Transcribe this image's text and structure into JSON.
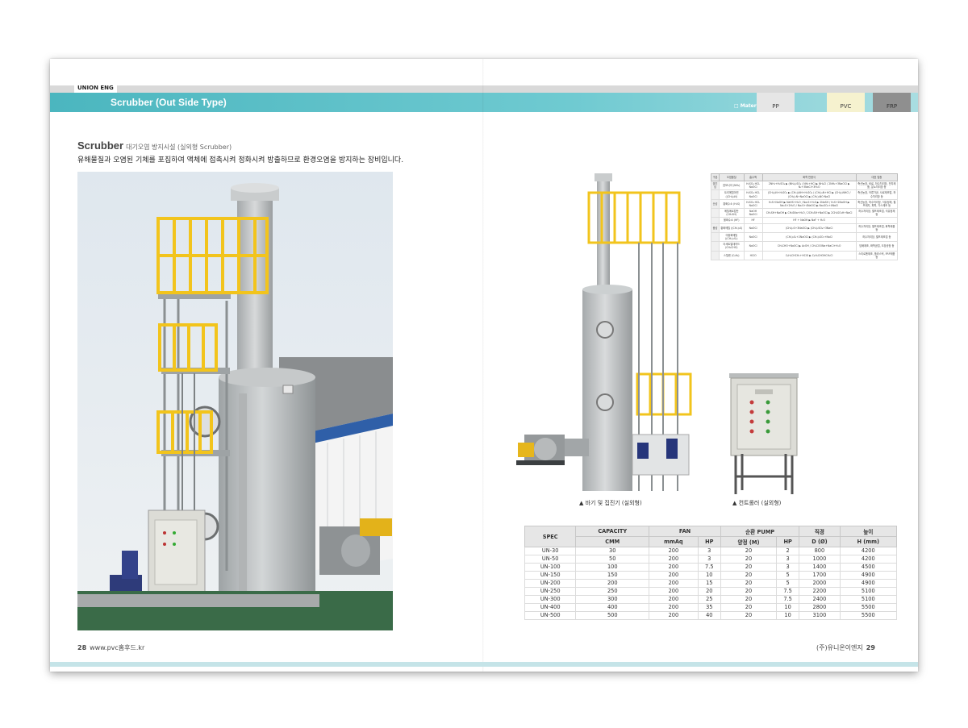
{
  "header": {
    "brand": "UNION ENG",
    "title": "Scrubber (Out Side Type)",
    "material_label": "□ Material",
    "materials": [
      "PP",
      "PVC",
      "FRP"
    ]
  },
  "left_page": {
    "heading": "Scrubber",
    "subheading": "대기오염 방지시설 (실외형 Scrubber)",
    "description": "유해물질과 오염된 기체를 포집하여 액체에 접촉시켜 정화시켜 방출하므로 환경오염을 방지하는 장비입니다.",
    "page_number": "28",
    "website": "www.pvc홈후드.kr"
  },
  "right_page": {
    "caption_scrubber": "▲ 바기 및 집진기 (실외형)",
    "caption_panel": "▲ 컨트롤러 (실외형)",
    "company": "(주)유니온이엔지",
    "page_number": "29"
  },
  "chem_table": {
    "headers": [
      "구분",
      "오염물질",
      "흡수액",
      "화학 반응식",
      "대표 업종"
    ],
    "rows": [
      {
        "cat": "염기성",
        "pollutant": "암모니아 (NH₃)",
        "absorbent": "H₂SO₄ HCL NaOCl",
        "reaction": "2NH₃+H₂SO₄ ▶ (NH₄)₂SO₄ / NH₃+HCl ▶ NH₄Cl / 2NH₃+3NaOCl ▶ N₂+3NaCl+3H₂O",
        "industry": "축산농장, 비료, 하수처리장, 전자제품, 분뇨처리장 등"
      },
      {
        "cat": "",
        "pollutant": "트리메틸아민 ((CH₃)₃N)",
        "absorbent": "H₂SO₄ HCL NaOCl",
        "reaction": "(CH₃)₃N+H₂SO₄ ▶ (CH₃)₃NH+H₂SO₄ / (CH₃)₃N+HCl ▶ (CH₃)₃NHCl / (CH₃)₃N+NaOCl ▶ (CH₃)₃NO·NaCl",
        "industry": "축산농장, 어류가공, 사료제조업, 하수처리장 등"
      },
      {
        "cat": "산성",
        "pollutant": "황화수소 (H₂S)",
        "absorbent": "H₂SO₄ HCL NaOCl",
        "reaction": "H₂S+NaOH ▶ NaHS+H₂O / Na₂S+H₂S ▶ 2NaSH / H₂S+2NaOH ▶ Na₂S+2H₂O / Na₂S+4NaOCl ▶ Na₂SO₄+4NaCl",
        "industry": "축산농장, 하수처리장, 석유정제, 펄프제지, 피혁, 가스제조 등"
      },
      {
        "cat": "",
        "pollutant": "메틸메르캅탄 (CH₃SH)",
        "absorbent": "NaOH NaOCl",
        "reaction": "CH₃SH+NaOH ▶ CH₃SNa+H₂O / 2CH₃SH+NaOCl ▶ 2CH₃SO₃H+NaCl",
        "industry": "하수처리장, 펄프제조업, 석유정제 등"
      },
      {
        "cat": "",
        "pollutant": "불화수소 (HF)",
        "absorbent": "HF",
        "reaction": "HF + NaOH ▶ NaF + H₂O",
        "industry": ""
      },
      {
        "cat": "중성",
        "pollutant": "황화메틸 ((CH₃)₂S)",
        "absorbent": "NaOCl",
        "reaction": "(CH₃)₂S+3NaOCl ▶ (CH₃)₂SO₄+3NaCl",
        "industry": "하수처리장, 펄프제조업, 화학제품 등"
      },
      {
        "cat": "",
        "pollutant": "이황화메틸 ((CH₃)₂S₂)",
        "absorbent": "NaOCl",
        "reaction": "(CH₃)₂S₂+2NaOCl ▶ (CH₃)₂SO₂+NaCl",
        "industry": "하수처리장, 펄프제조업 등"
      },
      {
        "cat": "",
        "pollutant": "아세트알데히드 (CH₃CHO)",
        "absorbent": "NaOCl",
        "reaction": "CH₃CHO+NaOCl ▶ AcOH / CH₃COONa+NaCl+H₂O",
        "industry": "담배제조, 화학공업, 도장공정 등"
      },
      {
        "cat": "",
        "pollutant": "스틸렌 (C₈H₈)",
        "absorbent": "HClO",
        "reaction": "C₆H₅CHCH₂+HClO ▶ C₆H₅CHOHCH₂Cl",
        "industry": "스티로폼제조, 플라스틱, FRP제품 등"
      }
    ]
  },
  "spec_table": {
    "group_headers": [
      "SPEC",
      "CAPACITY",
      "FAN",
      "순환 PUMP",
      "직경",
      "높이"
    ],
    "sub_headers": [
      "CMM",
      "mmAq",
      "HP",
      "양정 (M)",
      "HP",
      "D (Ø)",
      "H (mm)"
    ],
    "rows": [
      [
        "UN-30",
        "30",
        "200",
        "3",
        "20",
        "2",
        "800",
        "4200"
      ],
      [
        "UN-50",
        "50",
        "200",
        "3",
        "20",
        "3",
        "1000",
        "4200"
      ],
      [
        "UN-100",
        "100",
        "200",
        "7.5",
        "20",
        "3",
        "1400",
        "4500"
      ],
      [
        "UN-150",
        "150",
        "200",
        "10",
        "20",
        "5",
        "1700",
        "4900"
      ],
      [
        "UN-200",
        "200",
        "200",
        "15",
        "20",
        "5",
        "2000",
        "4900"
      ],
      [
        "UN-250",
        "250",
        "200",
        "20",
        "20",
        "7.5",
        "2200",
        "5100"
      ],
      [
        "UN-300",
        "300",
        "200",
        "25",
        "20",
        "7.5",
        "2400",
        "5100"
      ],
      [
        "UN-400",
        "400",
        "200",
        "35",
        "20",
        "10",
        "2800",
        "5500"
      ],
      [
        "UN-500",
        "500",
        "200",
        "40",
        "20",
        "10",
        "3100",
        "5500"
      ]
    ]
  },
  "colors": {
    "teal": "#4bb6bf",
    "railing_yellow": "#f2c41c",
    "tank_grey": "#b5b9ba"
  }
}
